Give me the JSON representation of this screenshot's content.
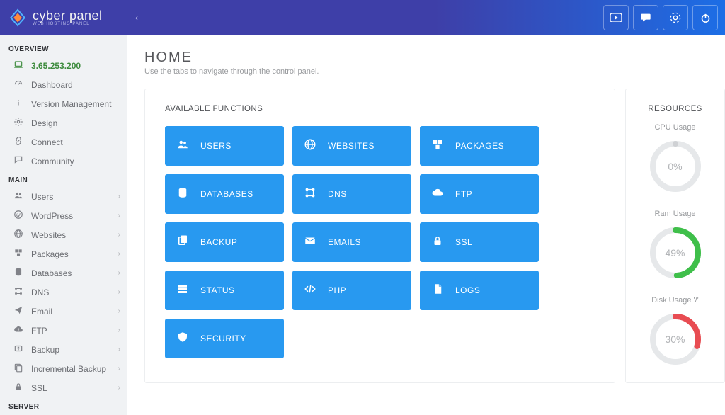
{
  "brand": {
    "title": "cyber panel",
    "subtitle": "WEB HOSTING PANEL"
  },
  "topbar_icons": [
    {
      "name": "youtube-icon"
    },
    {
      "name": "chat-icon"
    },
    {
      "name": "help-icon"
    },
    {
      "name": "power-icon"
    }
  ],
  "page": {
    "title": "HOME",
    "subtitle": "Use the tabs to navigate through the control panel."
  },
  "sidebar": {
    "sections": [
      {
        "heading": "OVERVIEW",
        "items": [
          {
            "label": "3.65.253.200",
            "icon": "laptop",
            "active": true,
            "chev": false
          },
          {
            "label": "Dashboard",
            "icon": "dashboard",
            "chev": false
          },
          {
            "label": "Version Management",
            "icon": "info",
            "chev": false
          },
          {
            "label": "Design",
            "icon": "gear",
            "chev": false
          },
          {
            "label": "Connect",
            "icon": "link",
            "chev": false
          },
          {
            "label": "Community",
            "icon": "chat",
            "chev": false
          }
        ]
      },
      {
        "heading": "MAIN",
        "items": [
          {
            "label": "Users",
            "icon": "users",
            "chev": true
          },
          {
            "label": "WordPress",
            "icon": "wordpress",
            "chev": true
          },
          {
            "label": "Websites",
            "icon": "globe",
            "chev": true
          },
          {
            "label": "Packages",
            "icon": "packages",
            "chev": true
          },
          {
            "label": "Databases",
            "icon": "database",
            "chev": true
          },
          {
            "label": "DNS",
            "icon": "dns",
            "chev": true
          },
          {
            "label": "Email",
            "icon": "send",
            "chev": true
          },
          {
            "label": "FTP",
            "icon": "cloud",
            "chev": true
          },
          {
            "label": "Backup",
            "icon": "backup",
            "chev": true
          },
          {
            "label": "Incremental Backup",
            "icon": "incbackup",
            "chev": true
          },
          {
            "label": "SSL",
            "icon": "lock",
            "chev": true
          }
        ]
      },
      {
        "heading": "SERVER",
        "items": []
      }
    ]
  },
  "functions": {
    "heading": "AVAILABLE FUNCTIONS",
    "tiles": [
      {
        "label": "USERS",
        "icon": "users"
      },
      {
        "label": "WEBSITES",
        "icon": "globe"
      },
      {
        "label": "PACKAGES",
        "icon": "packages"
      },
      {
        "label": "DATABASES",
        "icon": "database"
      },
      {
        "label": "DNS",
        "icon": "dns"
      },
      {
        "label": "FTP",
        "icon": "cloud"
      },
      {
        "label": "BACKUP",
        "icon": "copy"
      },
      {
        "label": "EMAILS",
        "icon": "mail"
      },
      {
        "label": "SSL",
        "icon": "lock"
      },
      {
        "label": "STATUS",
        "icon": "status"
      },
      {
        "label": "PHP",
        "icon": "code"
      },
      {
        "label": "LOGS",
        "icon": "file"
      },
      {
        "label": "SECURITY",
        "icon": "shield"
      }
    ]
  },
  "resources": {
    "heading": "RESOURCES",
    "gauges": [
      {
        "label": "CPU Usage",
        "percent": 0,
        "color": "#cfd1d4"
      },
      {
        "label": "Ram Usage",
        "percent": 49,
        "color": "#3fbf4a"
      },
      {
        "label": "Disk Usage '/'",
        "percent": 30,
        "color": "#e84c52"
      }
    ]
  }
}
